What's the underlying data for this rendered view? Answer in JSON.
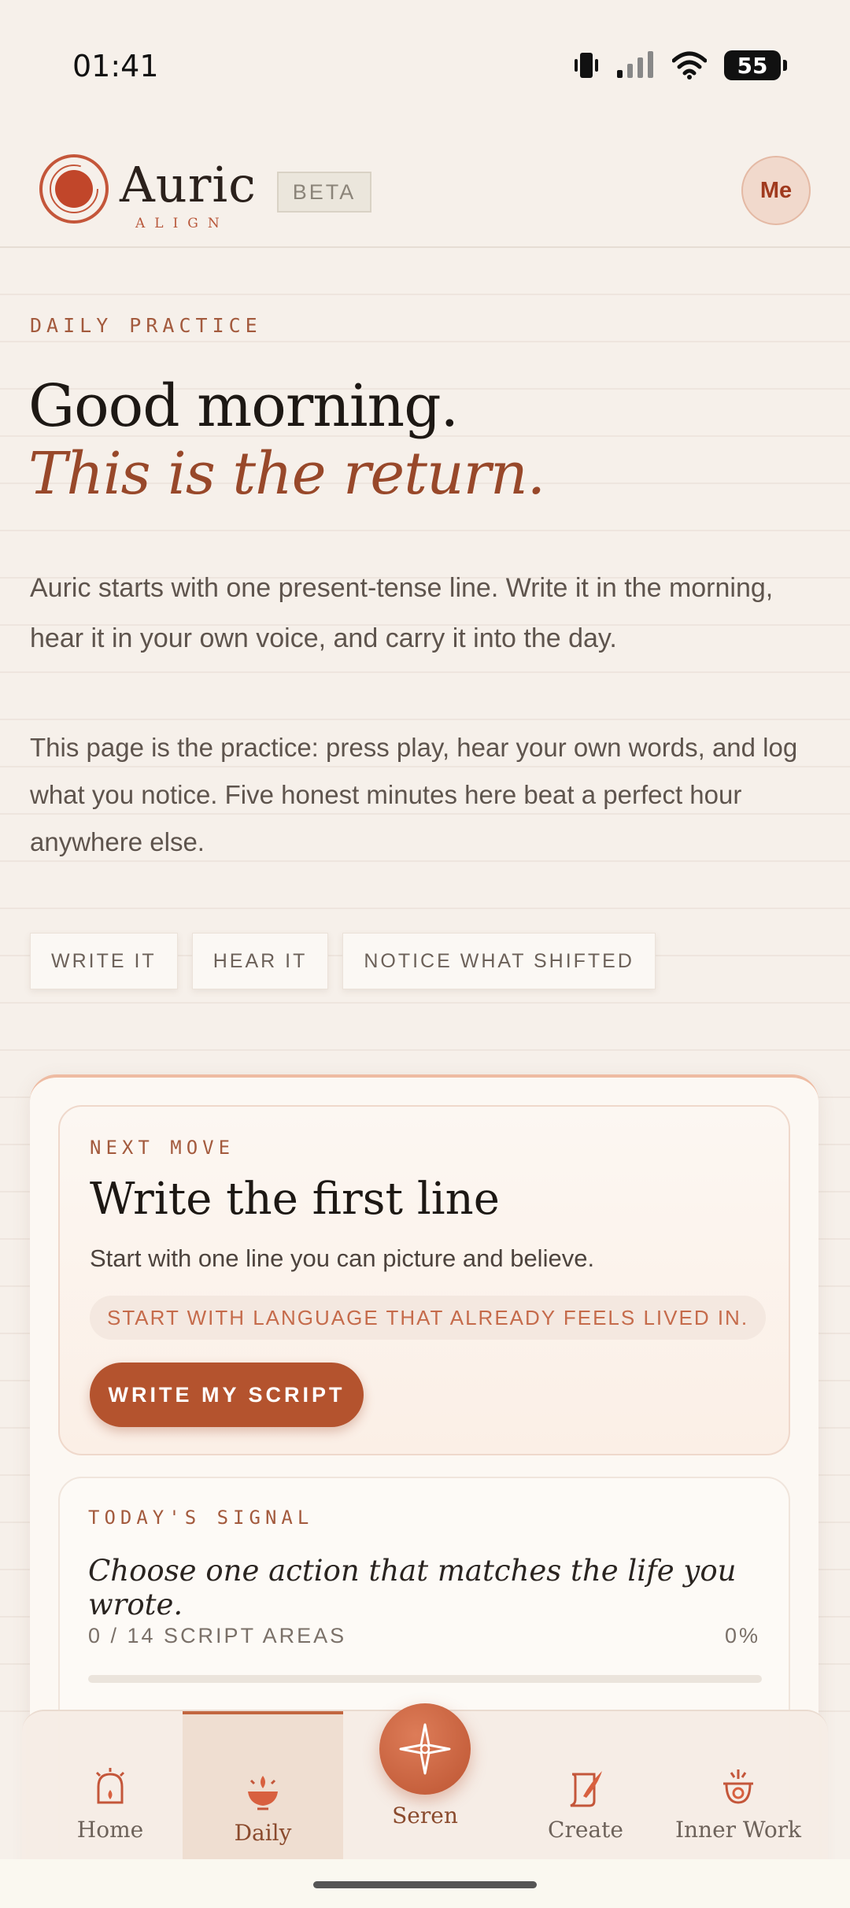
{
  "status_bar": {
    "time": "01:41",
    "battery": "55"
  },
  "header": {
    "brand": "Auric",
    "brand_sub": "ALIGN",
    "beta_label": "BETA",
    "profile_label": "Me"
  },
  "intro": {
    "eyebrow": "DAILY PRACTICE",
    "headline": "Good morning.",
    "headline_accent": "This is the return.",
    "paragraph_1": "Auric starts with one present-tense line. Write it in the morning, hear it in your own voice, and carry it into the day.",
    "paragraph_2": "This page is the practice: press play, hear your own words, and log what you notice. Five honest minutes here beat a perfect hour anywhere else.",
    "chips": [
      "WRITE IT",
      "HEAR IT",
      "NOTICE WHAT SHIFTED"
    ]
  },
  "next_move": {
    "eyebrow": "NEXT MOVE",
    "title": "Write the first line",
    "subtitle": "Start with one line you can picture and believe.",
    "hint": "START WITH LANGUAGE THAT ALREADY FEELS LIVED IN.",
    "button": "WRITE MY SCRIPT"
  },
  "signal": {
    "eyebrow": "TODAY'S SIGNAL",
    "text": "Choose one action that matches the life you wrote.",
    "areas": "0 / 14 SCRIPT AREAS",
    "percent": "0%",
    "progress": 0
  },
  "nav": {
    "items": [
      {
        "label": "Home",
        "icon": "home-arch-icon"
      },
      {
        "label": "Daily",
        "icon": "bowl-sunrise-icon",
        "active": true
      },
      {
        "label": "Seren",
        "icon": "sparkle-star-icon"
      },
      {
        "label": "Create",
        "icon": "scroll-quill-icon"
      },
      {
        "label": "Inner Work",
        "icon": "inner-spiral-icon"
      }
    ]
  },
  "colors": {
    "accent": "#b4532e",
    "background": "#f6f0ea",
    "accent_text": "#98482a"
  }
}
